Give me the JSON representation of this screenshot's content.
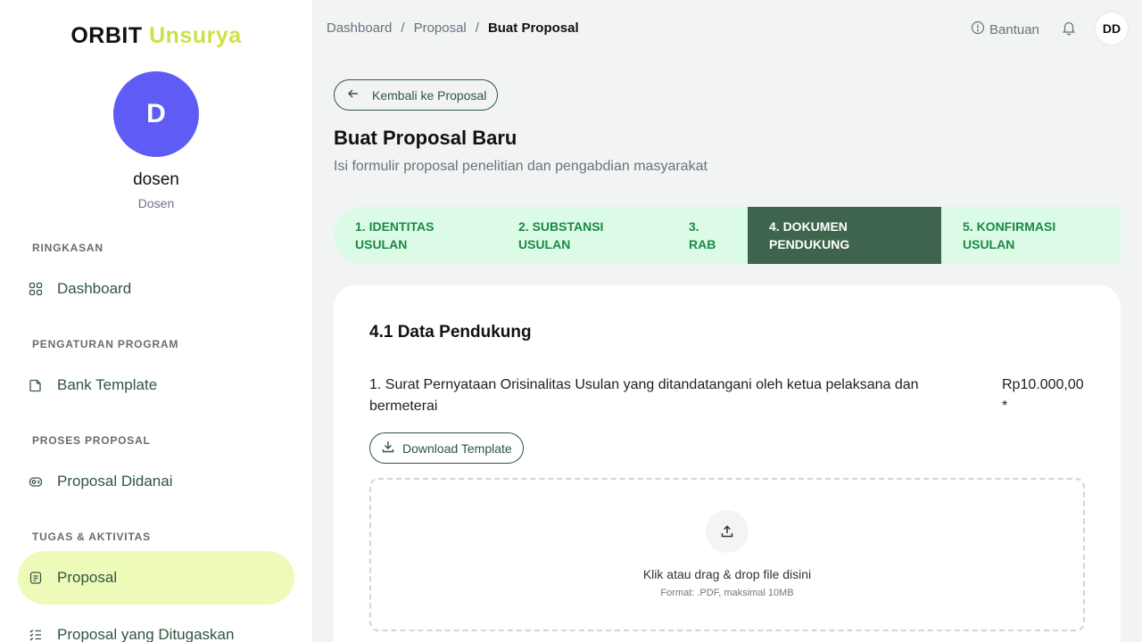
{
  "brand": {
    "primary": "ORBIT",
    "accent": "Unsurya"
  },
  "user": {
    "initial": "D",
    "name": "dosen",
    "role": "Dosen"
  },
  "sidebar": {
    "sections": [
      {
        "title": "RINGKASAN",
        "items": [
          {
            "label": "Dashboard",
            "icon": "grid-icon",
            "active": false
          }
        ]
      },
      {
        "title": "PENGATURAN PROGRAM",
        "items": [
          {
            "label": "Bank Template",
            "icon": "document-icon",
            "active": false
          }
        ]
      },
      {
        "title": "PROSES PROPOSAL",
        "items": [
          {
            "label": "Proposal Didanai",
            "icon": "money-icon",
            "active": false
          }
        ]
      },
      {
        "title": "TUGAS & AKTIVITAS",
        "items": [
          {
            "label": "Proposal",
            "icon": "file-list-icon",
            "active": true
          },
          {
            "label": "Proposal yang Ditugaskan",
            "icon": "task-list-icon",
            "active": false
          }
        ]
      }
    ]
  },
  "header": {
    "breadcrumb": [
      "Dashboard",
      "Proposal",
      "Buat Proposal"
    ],
    "help_label": "Bantuan",
    "avatar_initials": "DD"
  },
  "back_button": "Kembali ke Proposal",
  "page": {
    "title": "Buat Proposal Baru",
    "subtitle": "Isi formulir proposal penelitian dan pengabdian masyarakat"
  },
  "steps": [
    {
      "line1": "1. IDENTITAS",
      "line2": "USULAN",
      "active": false
    },
    {
      "line1": "2. SUBSTANSI",
      "line2": "USULAN",
      "active": false
    },
    {
      "line1": "3.",
      "line2": "RAB",
      "active": false
    },
    {
      "line1": "4. DOKUMEN",
      "line2": "PENDUKUNG",
      "active": true
    },
    {
      "line1": "5. KONFIRMASI",
      "line2": "USULAN",
      "active": false
    }
  ],
  "card": {
    "title": "4.1 Data Pendukung",
    "document": {
      "label": "1. Surat Pernyataan Orisinalitas Usulan yang ditandatangani oleh ketua pelaksana dan bermeterai",
      "price": "Rp10.000,00",
      "required_mark": "*",
      "download_label": "Download Template"
    },
    "dropzone": {
      "main_text": "Klik atau drag & drop file disini",
      "sub_text": "Format: .PDF, maksimal 10MB"
    }
  },
  "colors": {
    "brand_accent": "#cde04a",
    "avatar_bg": "#5f5cf6",
    "active_nav_bg": "#eefab8",
    "stepper_bg": "#dcfbe7",
    "stepper_active_bg": "#3e644e",
    "primary_green": "#2f5640"
  }
}
